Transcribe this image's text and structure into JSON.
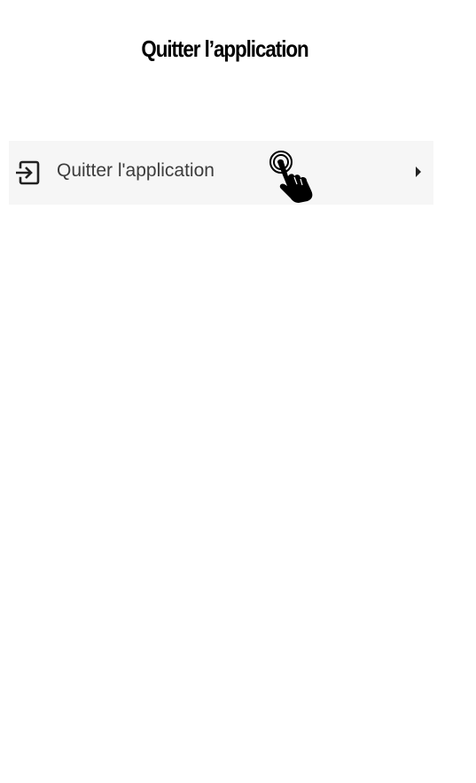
{
  "header": {
    "title": "Quitter l’application"
  },
  "menu": {
    "item": {
      "label": "Quitter l'application",
      "icon": "exit-to-app-icon",
      "trailing_icon": "chevron-right-icon"
    }
  },
  "overlay": {
    "icon": "tap-hand-icon"
  },
  "colors": {
    "row_background": "#f6f6f6",
    "text": "#3c3c3c",
    "icon": "#222222"
  }
}
